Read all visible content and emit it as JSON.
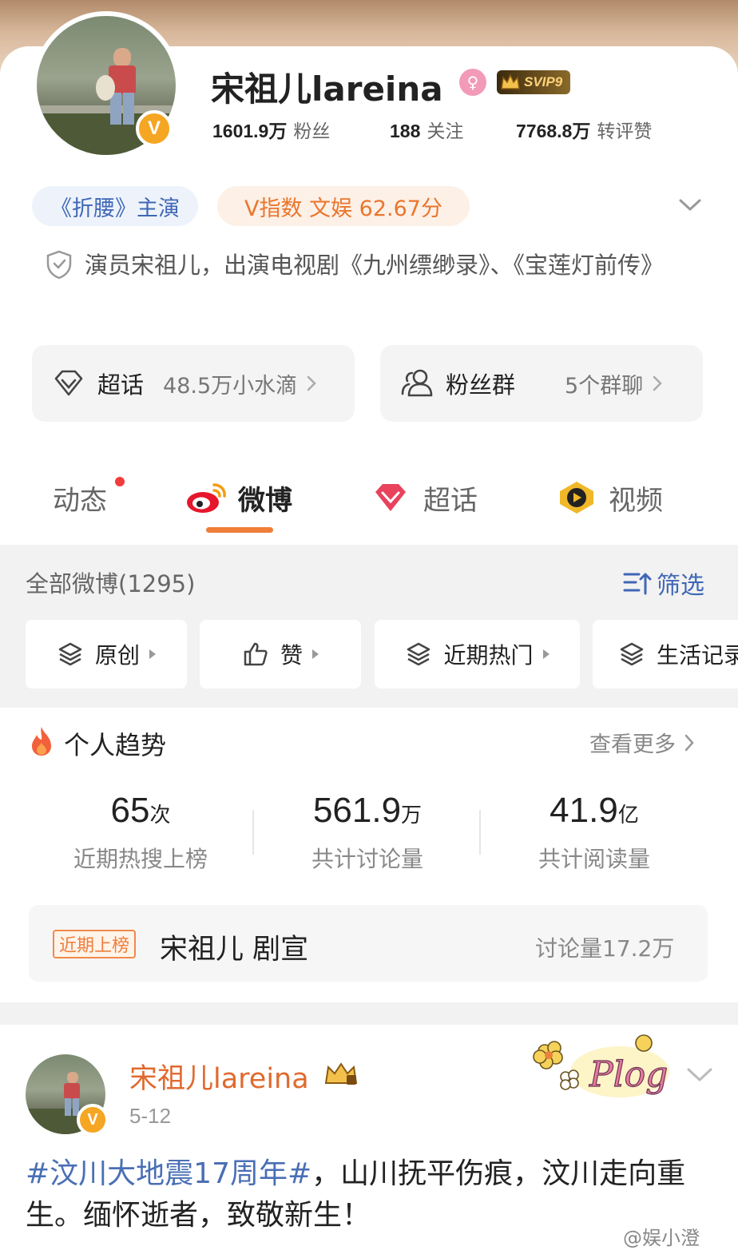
{
  "profile": {
    "name": "宋祖儿lareina",
    "gender_symbol": "♀",
    "vip_label": "SVIP9",
    "verified_mark": "V",
    "stats": [
      {
        "value": "1601.9万",
        "label": "粉丝"
      },
      {
        "value": "188",
        "label": "关注"
      },
      {
        "value": "7768.8万",
        "label": "转评赞"
      }
    ],
    "tags": {
      "role": "《折腰》主演",
      "vindex": "V指数 文娱 62.67分"
    },
    "bio": "演员宋祖儿，出演电视剧《九州缥缈录》、《宝莲灯前传》"
  },
  "quick_links": {
    "supertopic": {
      "label": "超话",
      "value": "48.5万小水滴"
    },
    "fangroup": {
      "label": "粉丝群",
      "value": "5个群聊"
    }
  },
  "tabs": [
    {
      "label": "动态"
    },
    {
      "label": "微博"
    },
    {
      "label": "超话"
    },
    {
      "label": "视频"
    }
  ],
  "feed_header": {
    "all_weibo": "全部微博(1295)",
    "filter": "筛选"
  },
  "chips": [
    "原创",
    "赞",
    "近期热门",
    "生活记录"
  ],
  "trend": {
    "title": "个人趋势",
    "more": "查看更多",
    "metrics": [
      {
        "num": "65",
        "unit": "次",
        "caption": "近期热搜上榜"
      },
      {
        "num": "561.9",
        "unit": "万",
        "caption": "共计讨论量"
      },
      {
        "num": "41.9",
        "unit": "亿",
        "caption": "共计阅读量"
      }
    ],
    "hot": {
      "tag": "近期上榜",
      "topic": "宋祖儿 剧宣",
      "discussion": "讨论量17.2万"
    }
  },
  "post": {
    "author": "宋祖儿lareina",
    "date": "5-12",
    "hashtag": "#汶川大地震17周年#",
    "text": "，山川抚平伤痕，汶川走向重生。缅怀逝者，致敬新生！",
    "sticker_text": "Plog"
  },
  "watermark": "@娱小澄",
  "colors": {
    "accent_orange": "#f07d3a",
    "link_blue": "#4a6fb5",
    "vip_gold": "#ffd27a",
    "red_dot": "#f23b3b"
  }
}
